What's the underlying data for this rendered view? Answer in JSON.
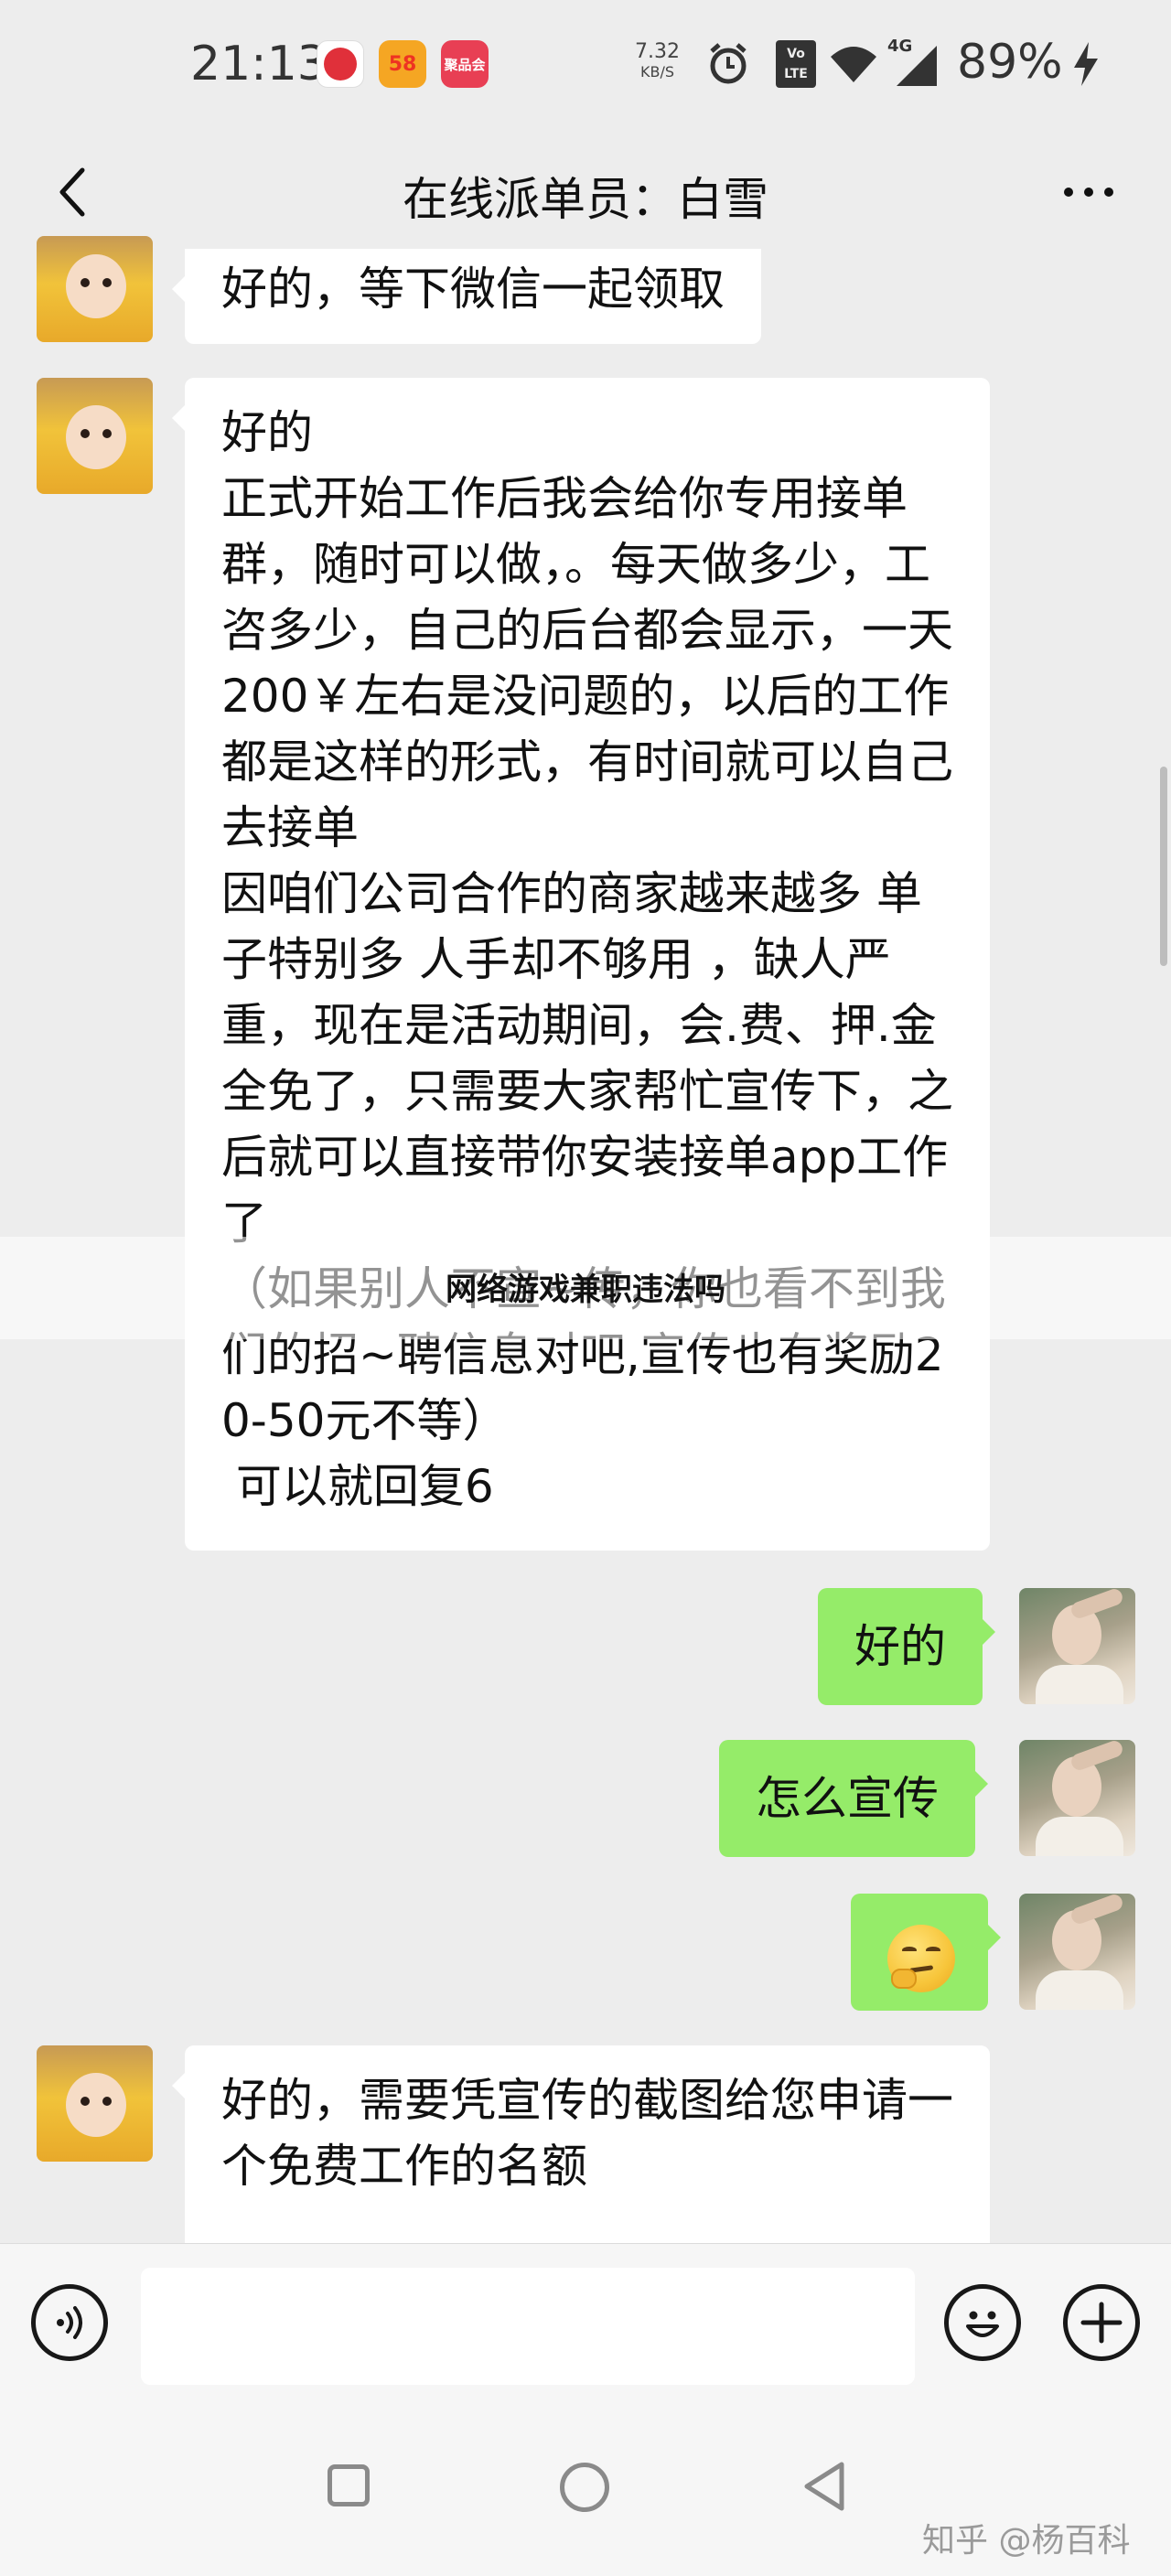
{
  "status_bar": {
    "time": "21:13",
    "net_speed_value": "7.32",
    "net_speed_unit": "KB/S",
    "volte_label": "Vo LTE",
    "network_label": "4G",
    "battery": "89%",
    "app_badges": [
      "58同城",
      "聚品会"
    ]
  },
  "header": {
    "title": "在线派单员：白雪"
  },
  "messages": [
    {
      "side": "left",
      "text": "好的，等下微信一起领取"
    },
    {
      "side": "left",
      "text": "好的\n正式开始工作后我会给你专用接单群，随时可以做，。每天做多少，工咨多少，自己的后台都会显示，一天200￥左右是没问题的，以后的工作都是这样的形式，有时间就可以自己去接单\n因咱们公司合作的商家越来越多 单子特别多 人手却不够用 ，缺人严重，现在是活动期间，会.费、押.金全免了，只需要大家帮忙宣传下，之后就可以直接带你安装接单app工作了\n（如果别人不宣~传，你也看不到我们的招~聘信息对吧,宣传也有奖励20-50元不等）\n 可以就回复6"
    },
    {
      "side": "right",
      "text": "好的"
    },
    {
      "side": "right",
      "text": "怎么宣传"
    },
    {
      "side": "right",
      "text": "",
      "emoji": "thinking-emoji"
    },
    {
      "side": "left",
      "text": "好的，需要凭宣传的截图给您申请一个免费工作的名额"
    }
  ],
  "overlay": {
    "text": "网络游戏兼职违法吗"
  },
  "input_bar": {
    "value": "",
    "placeholder": ""
  },
  "footer": {
    "watermark": "知乎 @杨百科"
  },
  "icons": {
    "back": "chevron-left-icon",
    "more": "more-dots-icon",
    "voice": "voice-icon",
    "emoji": "smiley-icon",
    "plus": "plus-icon"
  },
  "colors": {
    "background": "#ededed",
    "bubble_left": "#ffffff",
    "bubble_right": "#95ec69",
    "input_bar": "#f6f6f6"
  }
}
